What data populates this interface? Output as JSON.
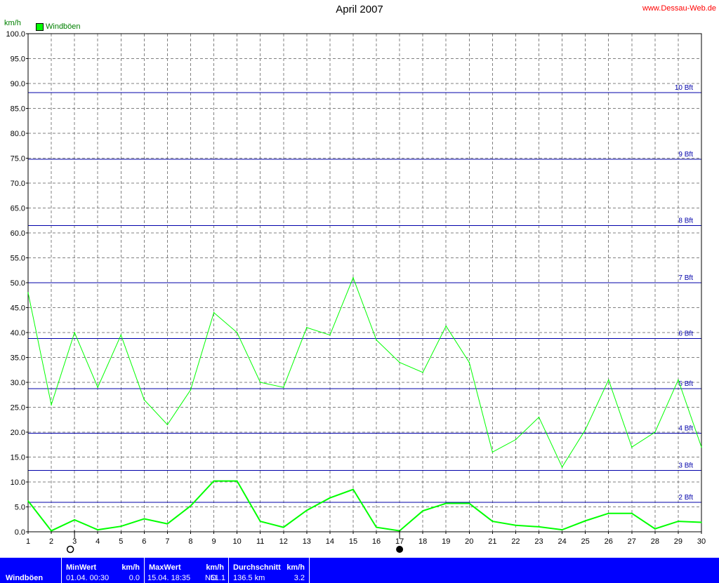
{
  "header": {
    "title": "April 2007",
    "site": "www.Dessau-Web.de",
    "unit": "km/h",
    "legend": "Windböen"
  },
  "colors": {
    "series": "#00ff00",
    "beaufort_lines": "#0000aa",
    "stats_bar": "#0000ff"
  },
  "moon_icons": [
    {
      "name": "new-moon-icon",
      "day": 3
    },
    {
      "name": "full-moon-icon",
      "day": 17
    }
  ],
  "chart_data": {
    "type": "line",
    "title": "April 2007",
    "ylabel": "km/h",
    "ylim": [
      0,
      100
    ],
    "xlim": [
      1,
      30
    ],
    "grid": true,
    "legend_position": "top-left",
    "x_ticks": [
      1,
      2,
      3,
      4,
      5,
      6,
      7,
      8,
      9,
      10,
      11,
      12,
      13,
      14,
      15,
      16,
      17,
      18,
      19,
      20,
      21,
      22,
      23,
      24,
      25,
      26,
      27,
      28,
      29,
      30
    ],
    "y_ticks": [
      "0.0",
      "5.0",
      "10.0",
      "15.0",
      "20.0",
      "25.0",
      "30.0",
      "35.0",
      "40.0",
      "45.0",
      "50.0",
      "55.0",
      "60.0",
      "65.0",
      "70.0",
      "75.0",
      "80.0",
      "85.0",
      "90.0",
      "95.0",
      "100.0"
    ],
    "series": [
      {
        "name": "Windböen",
        "x": [
          1,
          2,
          3,
          4,
          5,
          6,
          7,
          8,
          9,
          10,
          11,
          12,
          13,
          14,
          15,
          16,
          17,
          18,
          19,
          20,
          21,
          22,
          23,
          24,
          25,
          26,
          27,
          28,
          29,
          30
        ],
        "values": [
          48.0,
          25.5,
          40.0,
          29.0,
          39.5,
          26.5,
          21.5,
          28.5,
          44.0,
          40.0,
          30.0,
          29.0,
          41.0,
          39.5,
          51.0,
          38.5,
          34.0,
          32.0,
          41.3,
          34.0,
          16.0,
          18.5,
          23.0,
          13.0,
          20.5,
          30.5,
          17.0,
          20.0,
          30.5,
          17.0
        ]
      },
      {
        "x": [
          1,
          2,
          3,
          4,
          5,
          6,
          7,
          8,
          9,
          10,
          11,
          12,
          13,
          14,
          15,
          16,
          17,
          18,
          19,
          20,
          21,
          22,
          23,
          24,
          25,
          26,
          27,
          28,
          29,
          30
        ],
        "values": [
          6.2,
          0.2,
          2.4,
          0.4,
          1.1,
          2.6,
          1.6,
          5.2,
          10.2,
          10.2,
          2.1,
          0.9,
          4.3,
          6.8,
          8.5,
          0.9,
          0.2,
          4.2,
          5.7,
          5.7,
          2.1,
          1.3,
          1.0,
          0.4,
          2.2,
          3.7,
          3.7,
          0.6,
          2.1,
          1.9
        ]
      }
    ],
    "reference_lines": [
      {
        "label": "2 Bft",
        "value": 5.9
      },
      {
        "label": "3 Bft",
        "value": 12.3
      },
      {
        "label": "4 Bft",
        "value": 19.8
      },
      {
        "label": "5 Bft",
        "value": 28.7
      },
      {
        "label": "6 Bft",
        "value": 38.8
      },
      {
        "label": "7 Bft",
        "value": 50.0
      },
      {
        "label": "8 Bft",
        "value": 61.5
      },
      {
        "label": "9 Bft",
        "value": 74.8
      },
      {
        "label": "10 Bft",
        "value": 88.2
      }
    ]
  },
  "stats": {
    "name": "Windböen",
    "min": {
      "header": "MinWert",
      "unit": "km/h",
      "time": "01.04. 00:30",
      "value": "0.0"
    },
    "max": {
      "header": "MaxWert",
      "unit": "km/h",
      "time": "15.04. 18:35",
      "direction": "NO",
      "value": "51.1"
    },
    "avg": {
      "header": "Durchschnitt",
      "unit": "km/h",
      "distance": "136.5 km",
      "value": "3.2"
    }
  }
}
